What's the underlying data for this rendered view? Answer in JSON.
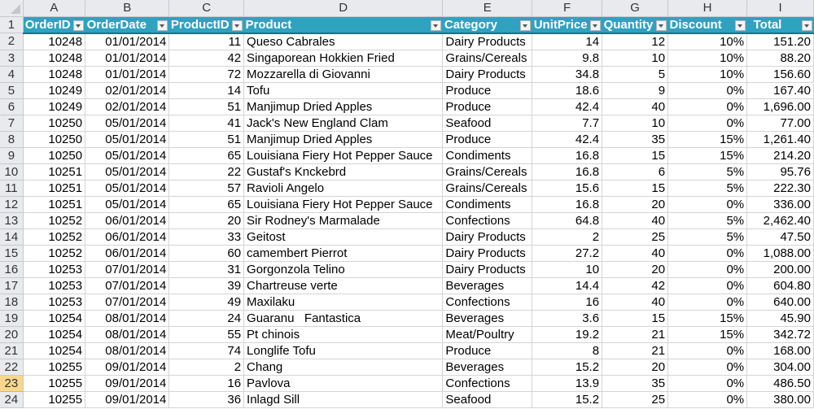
{
  "column_letters": [
    "A",
    "B",
    "C",
    "D",
    "E",
    "F",
    "G",
    "H",
    "I"
  ],
  "header_row_number": "1",
  "headers": [
    "OrderID",
    "OrderDate",
    "ProductID",
    "Product",
    "Category",
    "UnitPrice",
    "Quantity",
    "Discount",
    "Total"
  ],
  "selected_row": "23",
  "rows": [
    {
      "n": "2",
      "order_id": "10248",
      "order_date": "01/01/2014",
      "product_id": "11",
      "product": "Queso Cabrales",
      "category": "Dairy Products",
      "unit_price": "14",
      "quantity": "12",
      "discount": "10%",
      "total": "151.20"
    },
    {
      "n": "3",
      "order_id": "10248",
      "order_date": "01/01/2014",
      "product_id": "42",
      "product": "Singaporean Hokkien Fried",
      "category": "Grains/Cereals",
      "unit_price": "9.8",
      "quantity": "10",
      "discount": "10%",
      "total": "88.20"
    },
    {
      "n": "4",
      "order_id": "10248",
      "order_date": "01/01/2014",
      "product_id": "72",
      "product": "Mozzarella di Giovanni",
      "category": "Dairy Products",
      "unit_price": "34.8",
      "quantity": "5",
      "discount": "10%",
      "total": "156.60"
    },
    {
      "n": "5",
      "order_id": "10249",
      "order_date": "02/01/2014",
      "product_id": "14",
      "product": "Tofu",
      "category": "Produce",
      "unit_price": "18.6",
      "quantity": "9",
      "discount": "0%",
      "total": "167.40"
    },
    {
      "n": "6",
      "order_id": "10249",
      "order_date": "02/01/2014",
      "product_id": "51",
      "product": "Manjimup Dried Apples",
      "category": "Produce",
      "unit_price": "42.4",
      "quantity": "40",
      "discount": "0%",
      "total": "1,696.00"
    },
    {
      "n": "7",
      "order_id": "10250",
      "order_date": "05/01/2014",
      "product_id": "41",
      "product": "Jack's New England Clam",
      "category": "Seafood",
      "unit_price": "7.7",
      "quantity": "10",
      "discount": "0%",
      "total": "77.00"
    },
    {
      "n": "8",
      "order_id": "10250",
      "order_date": "05/01/2014",
      "product_id": "51",
      "product": "Manjimup Dried Apples",
      "category": "Produce",
      "unit_price": "42.4",
      "quantity": "35",
      "discount": "15%",
      "total": "1,261.40"
    },
    {
      "n": "9",
      "order_id": "10250",
      "order_date": "05/01/2014",
      "product_id": "65",
      "product": "Louisiana Fiery Hot Pepper Sauce",
      "category": "Condiments",
      "unit_price": "16.8",
      "quantity": "15",
      "discount": "15%",
      "total": "214.20"
    },
    {
      "n": "10",
      "order_id": "10251",
      "order_date": "05/01/2014",
      "product_id": "22",
      "product": "Gustaf's Knckebrd",
      "category": "Grains/Cereals",
      "unit_price": "16.8",
      "quantity": "6",
      "discount": "5%",
      "total": "95.76"
    },
    {
      "n": "11",
      "order_id": "10251",
      "order_date": "05/01/2014",
      "product_id": "57",
      "product": "Ravioli Angelo",
      "category": "Grains/Cereals",
      "unit_price": "15.6",
      "quantity": "15",
      "discount": "5%",
      "total": "222.30"
    },
    {
      "n": "12",
      "order_id": "10251",
      "order_date": "05/01/2014",
      "product_id": "65",
      "product": "Louisiana Fiery Hot Pepper Sauce",
      "category": "Condiments",
      "unit_price": "16.8",
      "quantity": "20",
      "discount": "0%",
      "total": "336.00"
    },
    {
      "n": "13",
      "order_id": "10252",
      "order_date": "06/01/2014",
      "product_id": "20",
      "product": "Sir Rodney's Marmalade",
      "category": "Confections",
      "unit_price": "64.8",
      "quantity": "40",
      "discount": "5%",
      "total": "2,462.40"
    },
    {
      "n": "14",
      "order_id": "10252",
      "order_date": "06/01/2014",
      "product_id": "33",
      "product": "Geitost",
      "category": "Dairy Products",
      "unit_price": "2",
      "quantity": "25",
      "discount": "5%",
      "total": "47.50"
    },
    {
      "n": "15",
      "order_id": "10252",
      "order_date": "06/01/2014",
      "product_id": "60",
      "product": "camembert Pierrot",
      "category": "Dairy Products",
      "unit_price": "27.2",
      "quantity": "40",
      "discount": "0%",
      "total": "1,088.00"
    },
    {
      "n": "16",
      "order_id": "10253",
      "order_date": "07/01/2014",
      "product_id": "31",
      "product": "Gorgonzola Telino",
      "category": "Dairy Products",
      "unit_price": "10",
      "quantity": "20",
      "discount": "0%",
      "total": "200.00"
    },
    {
      "n": "17",
      "order_id": "10253",
      "order_date": "07/01/2014",
      "product_id": "39",
      "product": "Chartreuse verte",
      "category": "Beverages",
      "unit_price": "14.4",
      "quantity": "42",
      "discount": "0%",
      "total": "604.80"
    },
    {
      "n": "18",
      "order_id": "10253",
      "order_date": "07/01/2014",
      "product_id": "49",
      "product": "Maxilaku",
      "category": "Confections",
      "unit_price": "16",
      "quantity": "40",
      "discount": "0%",
      "total": "640.00"
    },
    {
      "n": "19",
      "order_id": "10254",
      "order_date": "08/01/2014",
      "product_id": "24",
      "product": "Guaranu   Fantastica",
      "category": "Beverages",
      "unit_price": "3.6",
      "quantity": "15",
      "discount": "15%",
      "total": "45.90"
    },
    {
      "n": "20",
      "order_id": "10254",
      "order_date": "08/01/2014",
      "product_id": "55",
      "product": "Pt chinois",
      "category": "Meat/Poultry",
      "unit_price": "19.2",
      "quantity": "21",
      "discount": "15%",
      "total": "342.72"
    },
    {
      "n": "21",
      "order_id": "10254",
      "order_date": "08/01/2014",
      "product_id": "74",
      "product": "Longlife Tofu",
      "category": "Produce",
      "unit_price": "8",
      "quantity": "21",
      "discount": "0%",
      "total": "168.00"
    },
    {
      "n": "22",
      "order_id": "10255",
      "order_date": "09/01/2014",
      "product_id": "2",
      "product": "Chang",
      "category": "Beverages",
      "unit_price": "15.2",
      "quantity": "20",
      "discount": "0%",
      "total": "304.00"
    },
    {
      "n": "23",
      "order_id": "10255",
      "order_date": "09/01/2014",
      "product_id": "16",
      "product": "Pavlova",
      "category": "Confections",
      "unit_price": "13.9",
      "quantity": "35",
      "discount": "0%",
      "total": "486.50"
    },
    {
      "n": "24",
      "order_id": "10255",
      "order_date": "09/01/2014",
      "product_id": "36",
      "product": "Inlagd Sill",
      "category": "Seafood",
      "unit_price": "15.2",
      "quantity": "25",
      "discount": "0%",
      "total": "380.00"
    }
  ]
}
